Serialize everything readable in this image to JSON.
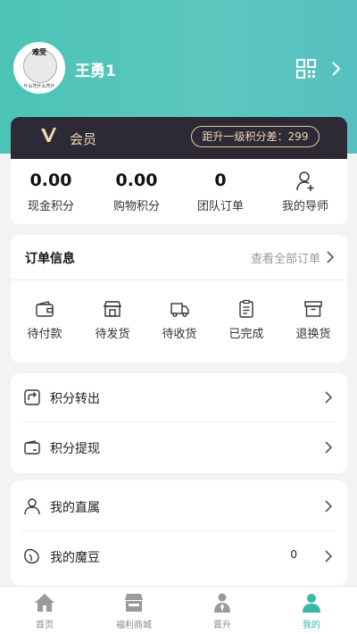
{
  "profile": {
    "username": "王勇1",
    "avatar_caption": "难受",
    "avatar_subcaption": "什么凭什么凭什"
  },
  "member": {
    "label": "会员",
    "progress_text": "距升一级积分差：299"
  },
  "stats": [
    {
      "value": "0.00",
      "label": "现金积分"
    },
    {
      "value": "0.00",
      "label": "购物积分"
    },
    {
      "value": "0",
      "label": "团队订单"
    },
    {
      "label": "我的导师",
      "icon": "person-add-icon"
    }
  ],
  "orders": {
    "title": "订单信息",
    "view_all": "查看全部订单",
    "items": [
      {
        "label": "待付款",
        "icon": "wallet-icon"
      },
      {
        "label": "待发货",
        "icon": "store-icon"
      },
      {
        "label": "待收货",
        "icon": "truck-icon"
      },
      {
        "label": "已完成",
        "icon": "clipboard-icon"
      },
      {
        "label": "退换货",
        "icon": "box-icon"
      }
    ]
  },
  "menu_points": [
    {
      "label": "积分转出",
      "icon": "transfer-icon"
    },
    {
      "label": "积分提现",
      "icon": "withdraw-icon"
    }
  ],
  "menu_team": [
    {
      "label": "我的直属",
      "icon": "person-icon"
    },
    {
      "label": "我的魔豆",
      "icon": "bean-icon",
      "count": "0"
    }
  ],
  "tabbar": [
    {
      "label": "首页",
      "icon": "home-icon",
      "active": false
    },
    {
      "label": "福利商城",
      "icon": "shop-icon",
      "active": false
    },
    {
      "label": "晋升",
      "icon": "promotion-icon",
      "active": false
    },
    {
      "label": "我的",
      "icon": "me-icon",
      "active": true
    }
  ],
  "colors": {
    "accent": "#3bb7a8",
    "header_gradient_start": "#4cc3b5",
    "member_bar": "#2e2a35",
    "member_gold": "#f0d7b4"
  }
}
